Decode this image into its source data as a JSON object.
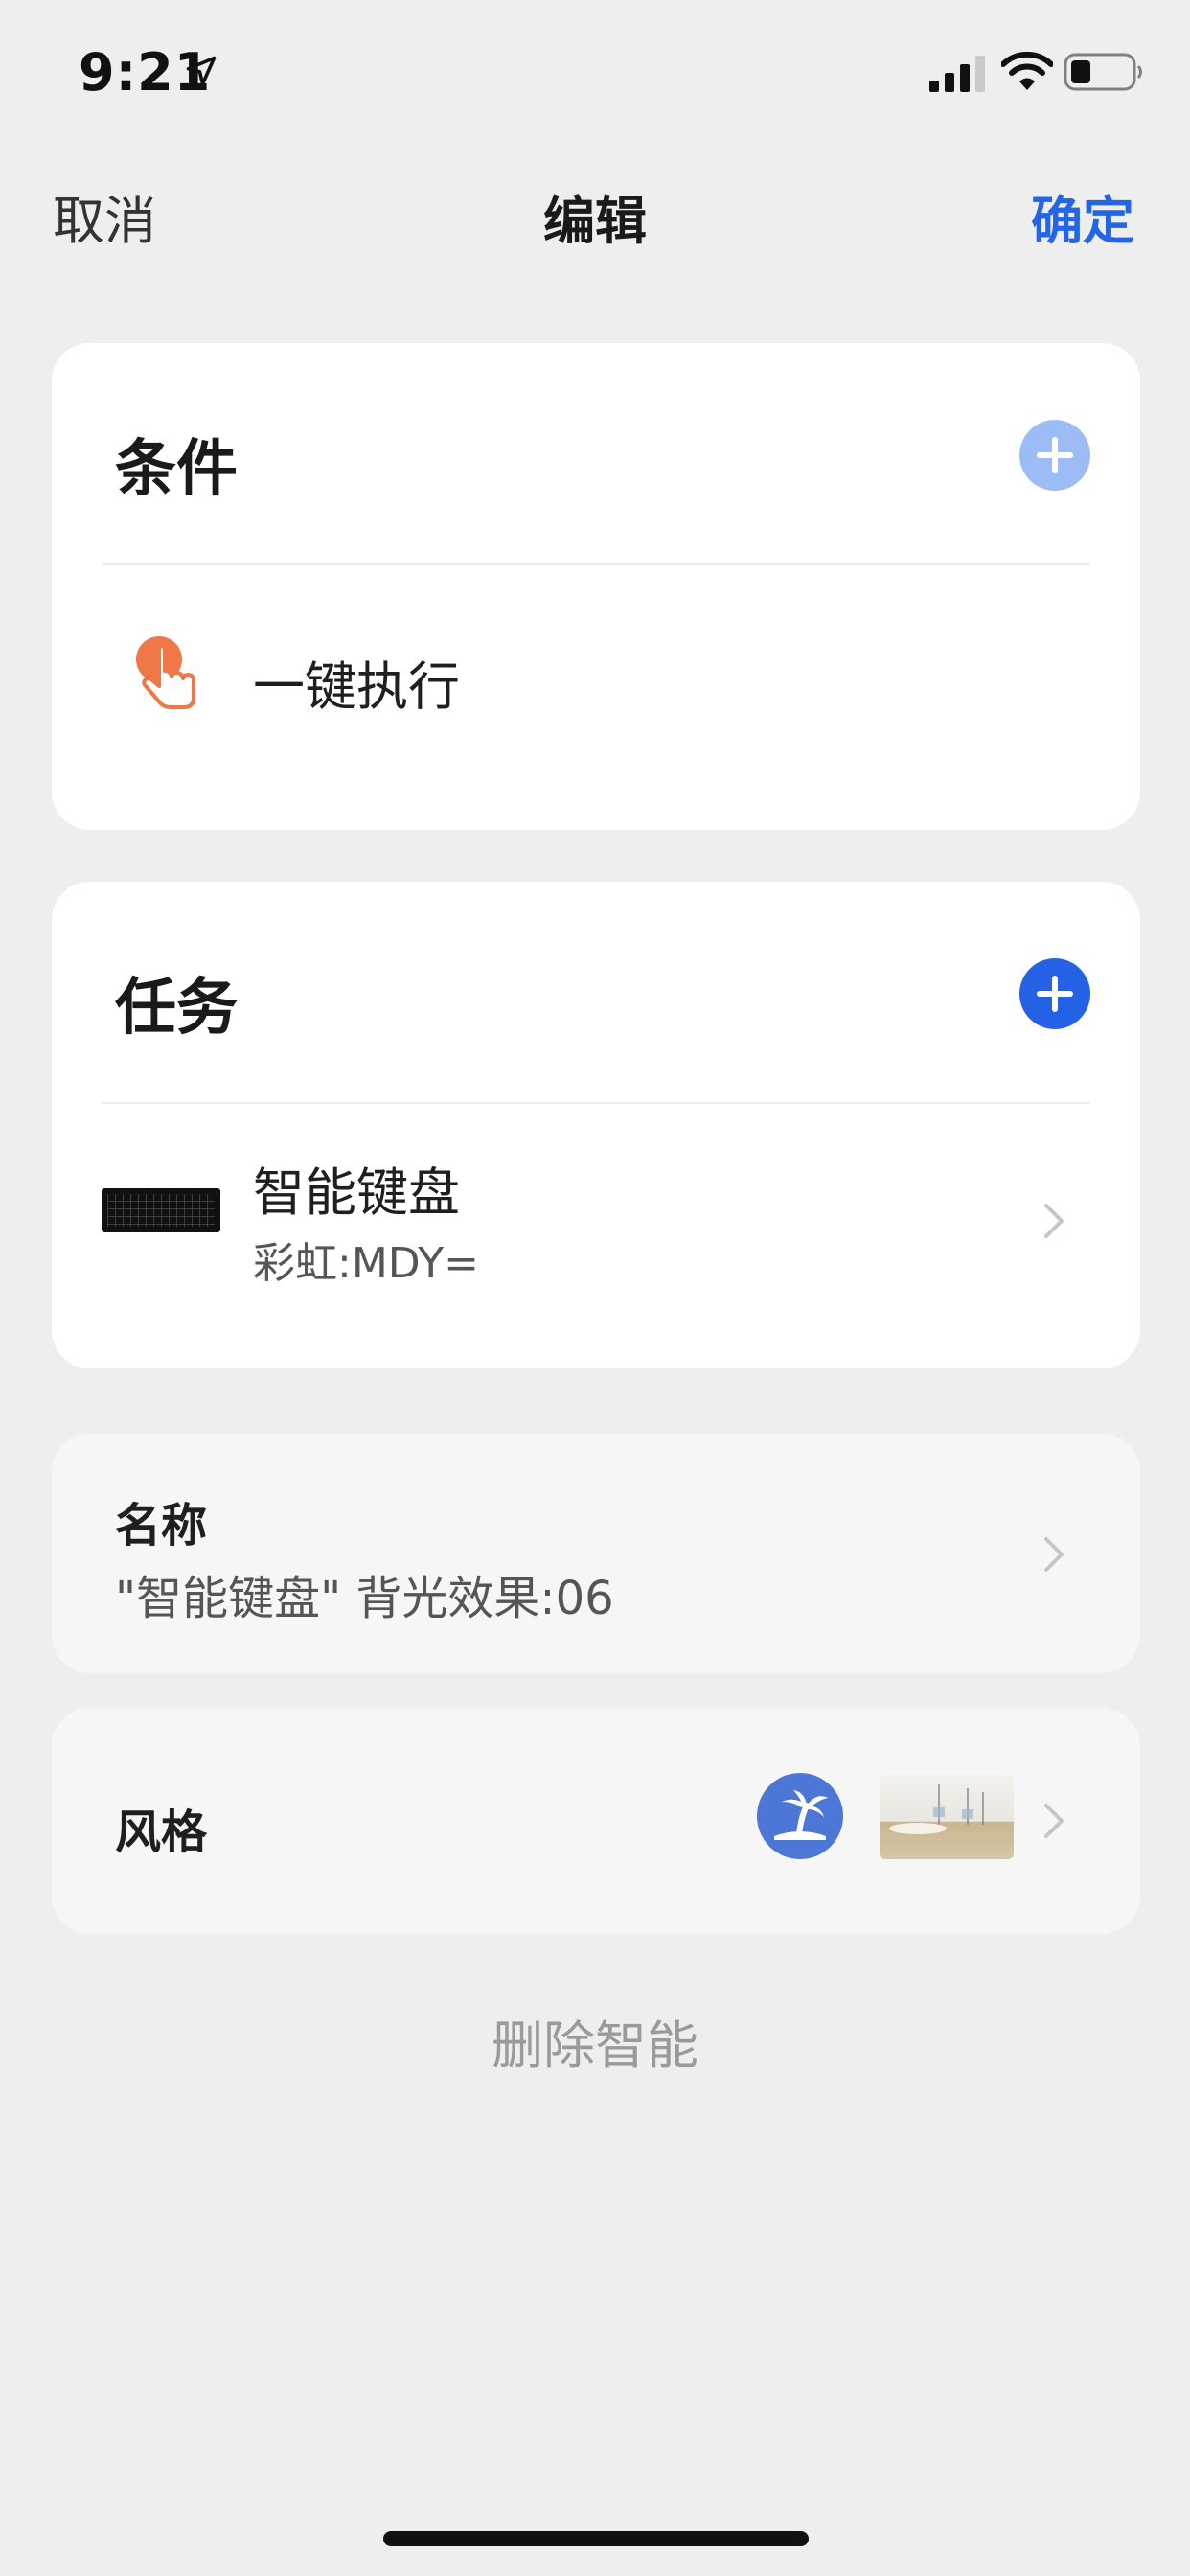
{
  "status_bar": {
    "time": "9:21"
  },
  "nav": {
    "cancel_label": "取消",
    "title": "编辑",
    "confirm_label": "确定"
  },
  "conditions": {
    "header": "条件",
    "items": [
      {
        "label": "一键执行",
        "icon": "tap-hand-icon"
      }
    ]
  },
  "tasks": {
    "header": "任务",
    "items": [
      {
        "title": "智能键盘",
        "subtitle": "彩虹:MDY=",
        "icon": "keyboard-thumbnail"
      }
    ]
  },
  "name_section": {
    "label": "名称",
    "value": "\"智能键盘\" 背光效果:06"
  },
  "style_section": {
    "label": "风格",
    "icon": "palm-tree-icon"
  },
  "actions": {
    "delete_label": "删除智能"
  },
  "colors": {
    "accent_blue": "#2464e6",
    "light_blue": "#9dbcf6",
    "hand_orange": "#f07848",
    "style_icon_blue": "#4d77d6",
    "background": "#eeeeef"
  }
}
